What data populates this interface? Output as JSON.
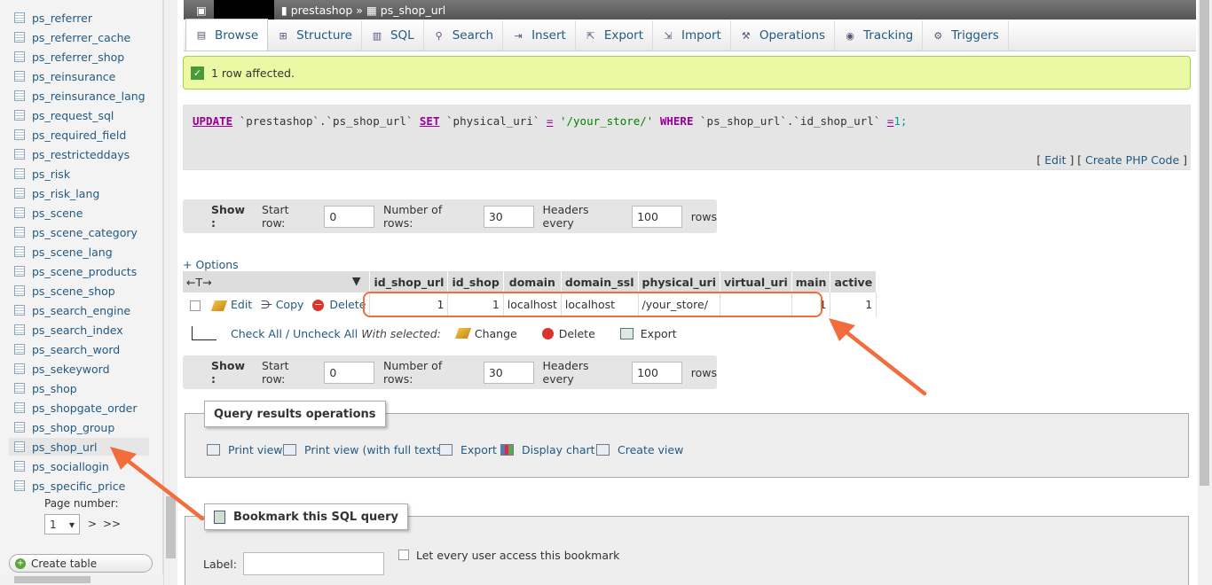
{
  "sidebar": {
    "items": [
      {
        "label": "ps_referrer"
      },
      {
        "label": "ps_referrer_cache"
      },
      {
        "label": "ps_referrer_shop"
      },
      {
        "label": "ps_reinsurance"
      },
      {
        "label": "ps_reinsurance_lang"
      },
      {
        "label": "ps_request_sql"
      },
      {
        "label": "ps_required_field"
      },
      {
        "label": "ps_restricteddays"
      },
      {
        "label": "ps_risk"
      },
      {
        "label": "ps_risk_lang"
      },
      {
        "label": "ps_scene"
      },
      {
        "label": "ps_scene_category"
      },
      {
        "label": "ps_scene_lang"
      },
      {
        "label": "ps_scene_products"
      },
      {
        "label": "ps_scene_shop"
      },
      {
        "label": "ps_search_engine"
      },
      {
        "label": "ps_search_index"
      },
      {
        "label": "ps_search_word"
      },
      {
        "label": "ps_sekeyword"
      },
      {
        "label": "ps_shop"
      },
      {
        "label": "ps_shopgate_order"
      },
      {
        "label": "ps_shop_group"
      },
      {
        "label": "ps_shop_url"
      },
      {
        "label": "ps_sociallogin"
      },
      {
        "label": "ps_specific_price"
      }
    ],
    "active_item": "ps_shop_url",
    "page_number_label": "Page number:",
    "page_number_value": "1",
    "next_label": ">",
    "last_label": ">>",
    "create_table_label": "Create table"
  },
  "breadcrumb": {
    "database": "prestashop",
    "separator": "»",
    "table": "ps_shop_url"
  },
  "tabs": [
    {
      "label": "Browse",
      "icon": "table-icon"
    },
    {
      "label": "Structure",
      "icon": "structure-icon"
    },
    {
      "label": "SQL",
      "icon": "sql-icon"
    },
    {
      "label": "Search",
      "icon": "search-icon"
    },
    {
      "label": "Insert",
      "icon": "insert-icon"
    },
    {
      "label": "Export",
      "icon": "export-icon"
    },
    {
      "label": "Import",
      "icon": "import-icon"
    },
    {
      "label": "Operations",
      "icon": "wrench-icon"
    },
    {
      "label": "Tracking",
      "icon": "eye-icon"
    },
    {
      "label": "Triggers",
      "icon": "triggers-icon"
    }
  ],
  "message": {
    "text": "1 row affected."
  },
  "sql": {
    "kw_update": "UPDATE",
    "db": "`prestashop`",
    "dot": ".",
    "table": "`ps_shop_url`",
    "kw_set": "SET",
    "col": "`physical_uri`",
    "eq": "=",
    "value": "'/your_store/'",
    "kw_where": "WHERE",
    "where_table": "`ps_shop_url`",
    "where_col": "`id_shop_url`",
    "eq2": "=",
    "num": "1",
    "end": ";",
    "edit_label": "Edit",
    "php_label": "Create PHP Code"
  },
  "show_bar": {
    "show_label": "Show :",
    "start_row_label": "Start row:",
    "start_row_value": "0",
    "num_rows_label": "Number of rows:",
    "num_rows_value": "30",
    "headers_every_label": "Headers every",
    "headers_every_value": "100",
    "rows_label": "rows"
  },
  "options_label": "+ Options",
  "sort_arrows": "←T→",
  "table": {
    "columns": [
      "id_shop_url",
      "id_shop",
      "domain",
      "domain_ssl",
      "physical_uri",
      "virtual_uri",
      "main",
      "active"
    ],
    "row": {
      "edit": "Edit",
      "copy": "Copy",
      "delete": "Delete",
      "cells": [
        "1",
        "1",
        "localhost",
        "localhost",
        "/your_store/",
        "",
        "1",
        "1"
      ]
    }
  },
  "with_selected": {
    "check_all": "Check All / Uncheck All",
    "with_selected": "With selected:",
    "change": "Change",
    "delete": "Delete",
    "export": "Export"
  },
  "query_ops": {
    "legend": "Query results operations",
    "print_view": "Print view",
    "print_view_full": "Print view (with full texts)",
    "export": "Export",
    "display_chart": "Display chart",
    "create_view": "Create view"
  },
  "bookmark": {
    "legend": "Bookmark this SQL query",
    "label_label": "Label:",
    "label_value": "",
    "share_label": "Let every user access this bookmark"
  },
  "colors": {
    "link": "#235a81",
    "highlight": "#f26c3c",
    "success_bg": "#ebf8a4"
  }
}
